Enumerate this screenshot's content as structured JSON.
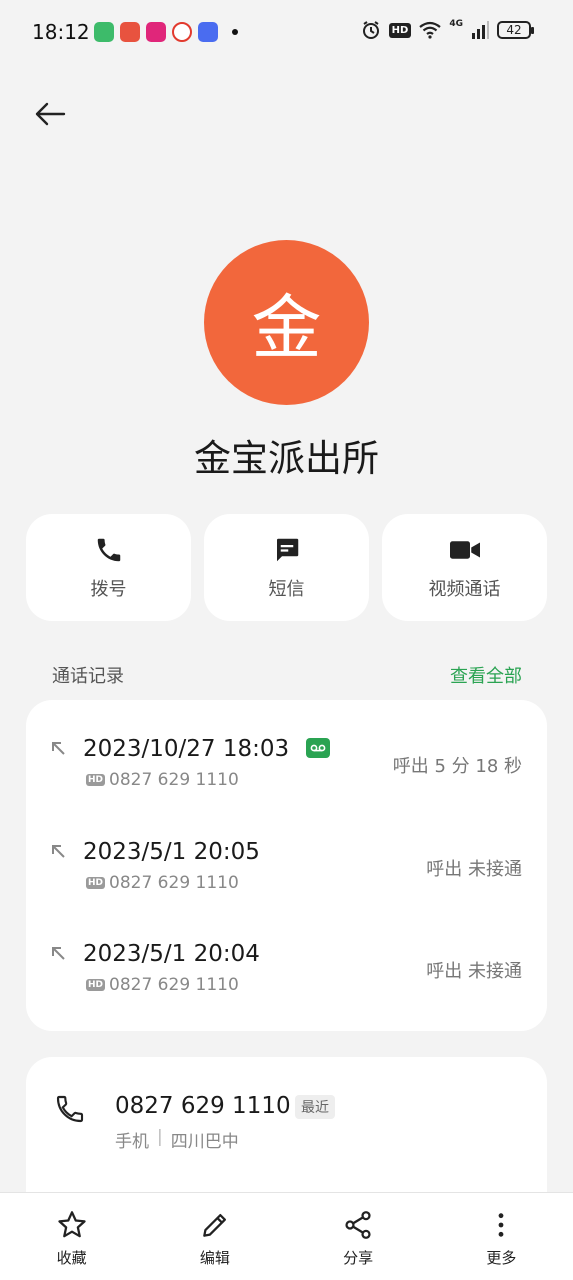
{
  "status_bar": {
    "time": "18:12",
    "battery": "42",
    "network": "4G",
    "hd": "HD"
  },
  "contact": {
    "avatar_char": "金",
    "name": "金宝派出所",
    "avatar_color": "#f2673c"
  },
  "actions": [
    {
      "label": "拨号",
      "icon": "phone-icon"
    },
    {
      "label": "短信",
      "icon": "message-icon"
    },
    {
      "label": "视频通话",
      "icon": "video-icon"
    }
  ],
  "call_log": {
    "title": "通话记录",
    "view_all": "查看全部",
    "entries": [
      {
        "datetime": "2023/10/27 18:03",
        "number": "0827 629 1110",
        "status": "呼出  5 分 18 秒",
        "recorded": true
      },
      {
        "datetime": "2023/5/1 20:05",
        "number": "0827 629 1110",
        "status": "呼出 未接通",
        "recorded": false
      },
      {
        "datetime": "2023/5/1 20:04",
        "number": "0827 629 1110",
        "status": "呼出 未接通",
        "recorded": false
      }
    ],
    "hd_tag": "HD"
  },
  "phone_number": {
    "value": "0827 629 1110",
    "tag": "最近",
    "type": "手机",
    "location": "四川巴中"
  },
  "bottom_bar": [
    {
      "label": "收藏",
      "icon": "star-icon"
    },
    {
      "label": "编辑",
      "icon": "pencil-icon"
    },
    {
      "label": "分享",
      "icon": "share-icon"
    },
    {
      "label": "更多",
      "icon": "more-icon"
    }
  ],
  "colors": {
    "accent_green": "#2aa352",
    "avatar": "#f2673c",
    "background": "#f3f3f3"
  }
}
